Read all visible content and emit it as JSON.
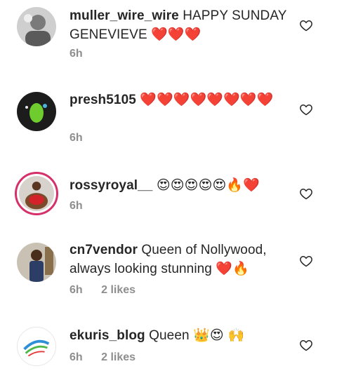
{
  "comments": [
    {
      "username": "muller_wire_wire",
      "text": "HAPPY SUNDAY GENEVIEVE",
      "emojis": "❤️❤️❤️",
      "time": "6h",
      "likes": ""
    },
    {
      "username": "presh5105",
      "text": "",
      "emojis": "❤️❤️❤️❤️❤️❤️❤️❤️",
      "time": "6h",
      "likes": ""
    },
    {
      "username": "rossyroyal__",
      "text": "",
      "emojis": "😍😍😍😍😍🔥❤️",
      "time": "6h",
      "likes": ""
    },
    {
      "username": "cn7vendor",
      "text": "Queen of Nollywood, always looking stunning",
      "emojis": "❤️🔥",
      "time": "6h",
      "likes": "2 likes"
    },
    {
      "username": "ekuris_blog",
      "text": "Queen",
      "emojis": "👑😍 🙌",
      "time": "6h",
      "likes": "2 likes"
    }
  ],
  "icons": {
    "like": "heart-outline-icon"
  },
  "colors": {
    "heart": "#e0242e",
    "muted": "#8e8e8e",
    "story_ring": "#d6306a"
  }
}
